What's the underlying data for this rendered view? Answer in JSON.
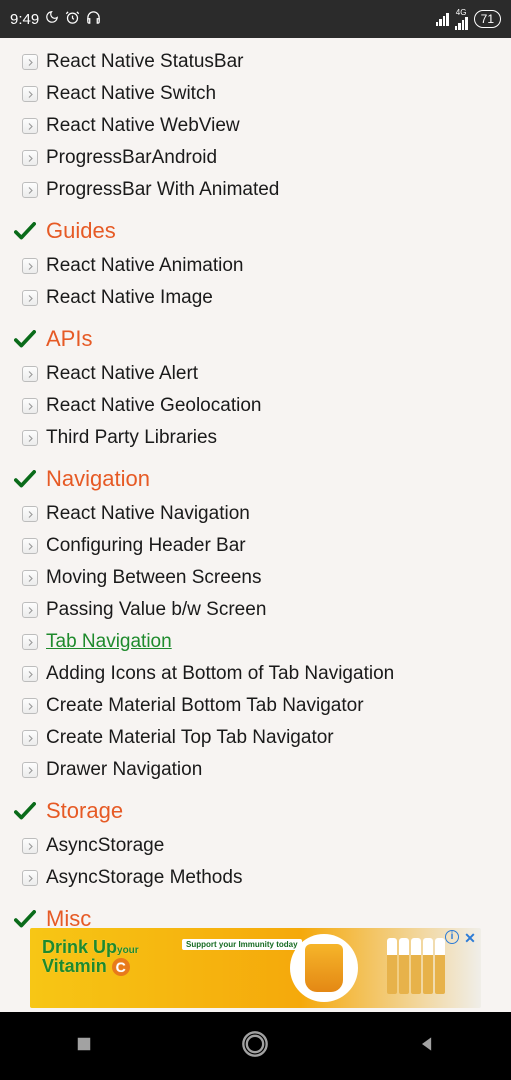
{
  "status": {
    "time": "9:49",
    "battery": "71",
    "network_label": "4G"
  },
  "top_items": [
    "React Native StatusBar",
    "React Native Switch",
    "React Native WebView",
    "ProgressBarAndroid",
    "ProgressBar With Animated"
  ],
  "sections": [
    {
      "title": "Guides",
      "items": [
        {
          "label": "React Native Animation",
          "active": false
        },
        {
          "label": "React Native Image",
          "active": false
        }
      ]
    },
    {
      "title": "APIs",
      "items": [
        {
          "label": "React Native Alert",
          "active": false
        },
        {
          "label": "React Native Geolocation",
          "active": false
        },
        {
          "label": "Third Party Libraries",
          "active": false
        }
      ]
    },
    {
      "title": "Navigation",
      "items": [
        {
          "label": "React Native Navigation",
          "active": false
        },
        {
          "label": "Configuring Header Bar",
          "active": false
        },
        {
          "label": "Moving Between Screens",
          "active": false
        },
        {
          "label": "Passing Value b/w Screen",
          "active": false
        },
        {
          "label": "Tab Navigation",
          "active": true
        },
        {
          "label": "Adding Icons at Bottom of Tab Navigation",
          "active": false
        },
        {
          "label": "Create Material Bottom Tab Navigator",
          "active": false
        },
        {
          "label": "Create Material Top Tab Navigator",
          "active": false
        },
        {
          "label": "Drawer Navigation",
          "active": false
        }
      ]
    },
    {
      "title": "Storage",
      "items": [
        {
          "label": "AsyncStorage",
          "active": false
        },
        {
          "label": "AsyncStorage Methods",
          "active": false
        }
      ]
    },
    {
      "title": "Misc",
      "items": []
    }
  ],
  "ad": {
    "line1": "Drink Up",
    "line1_small": "your",
    "line2": "Vitamin",
    "tagline": "Support your Immunity today"
  }
}
